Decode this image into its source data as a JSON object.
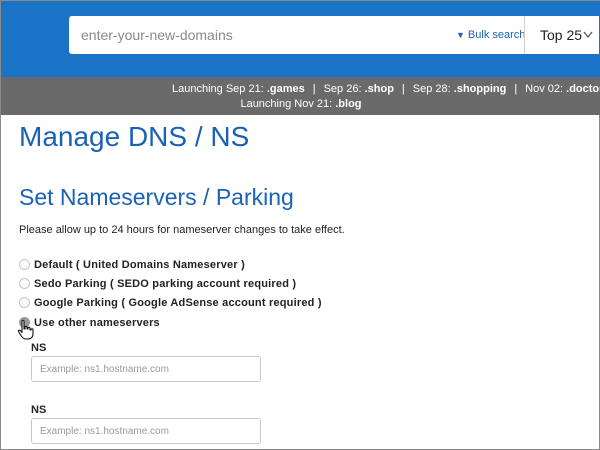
{
  "search": {
    "placeholder": "enter-your-new-domains",
    "bulk_label": "Bulk search",
    "top_select": "Top 25"
  },
  "announcement": {
    "line1": [
      {
        "prefix": "Launching Sep 21: ",
        "tld": ".games"
      },
      {
        "prefix": "Sep 26: ",
        "tld": ".shop"
      },
      {
        "prefix": "Sep 28: ",
        "tld": ".shopping"
      },
      {
        "prefix": "Nov 02: ",
        "tld": ".doctor"
      }
    ],
    "line2": {
      "prefix": "Launching Nov 21: ",
      "tld": ".blog"
    },
    "separator": "|"
  },
  "page": {
    "title": "Manage DNS / NS",
    "section_title": "Set Nameservers / Parking",
    "note": "Please allow up to 24 hours for nameserver changes to take effect."
  },
  "options": [
    {
      "label": "Default ( United Domains Nameserver )",
      "selected": false
    },
    {
      "label": "Sedo Parking ( SEDO parking account required )",
      "selected": false
    },
    {
      "label": "Google Parking ( Google AdSense account required )",
      "selected": false
    },
    {
      "label": "Use other nameservers",
      "selected": true
    }
  ],
  "nameservers": [
    {
      "label": "NS",
      "placeholder": "Example: ns1.hostname.com",
      "value": ""
    },
    {
      "label": "NS",
      "placeholder": "Example: ns1.hostname.com",
      "value": ""
    }
  ],
  "colors": {
    "brand_blue": "#1a73c6",
    "heading_blue": "#1a62b5",
    "announce_bar": "#6a6a6a"
  }
}
